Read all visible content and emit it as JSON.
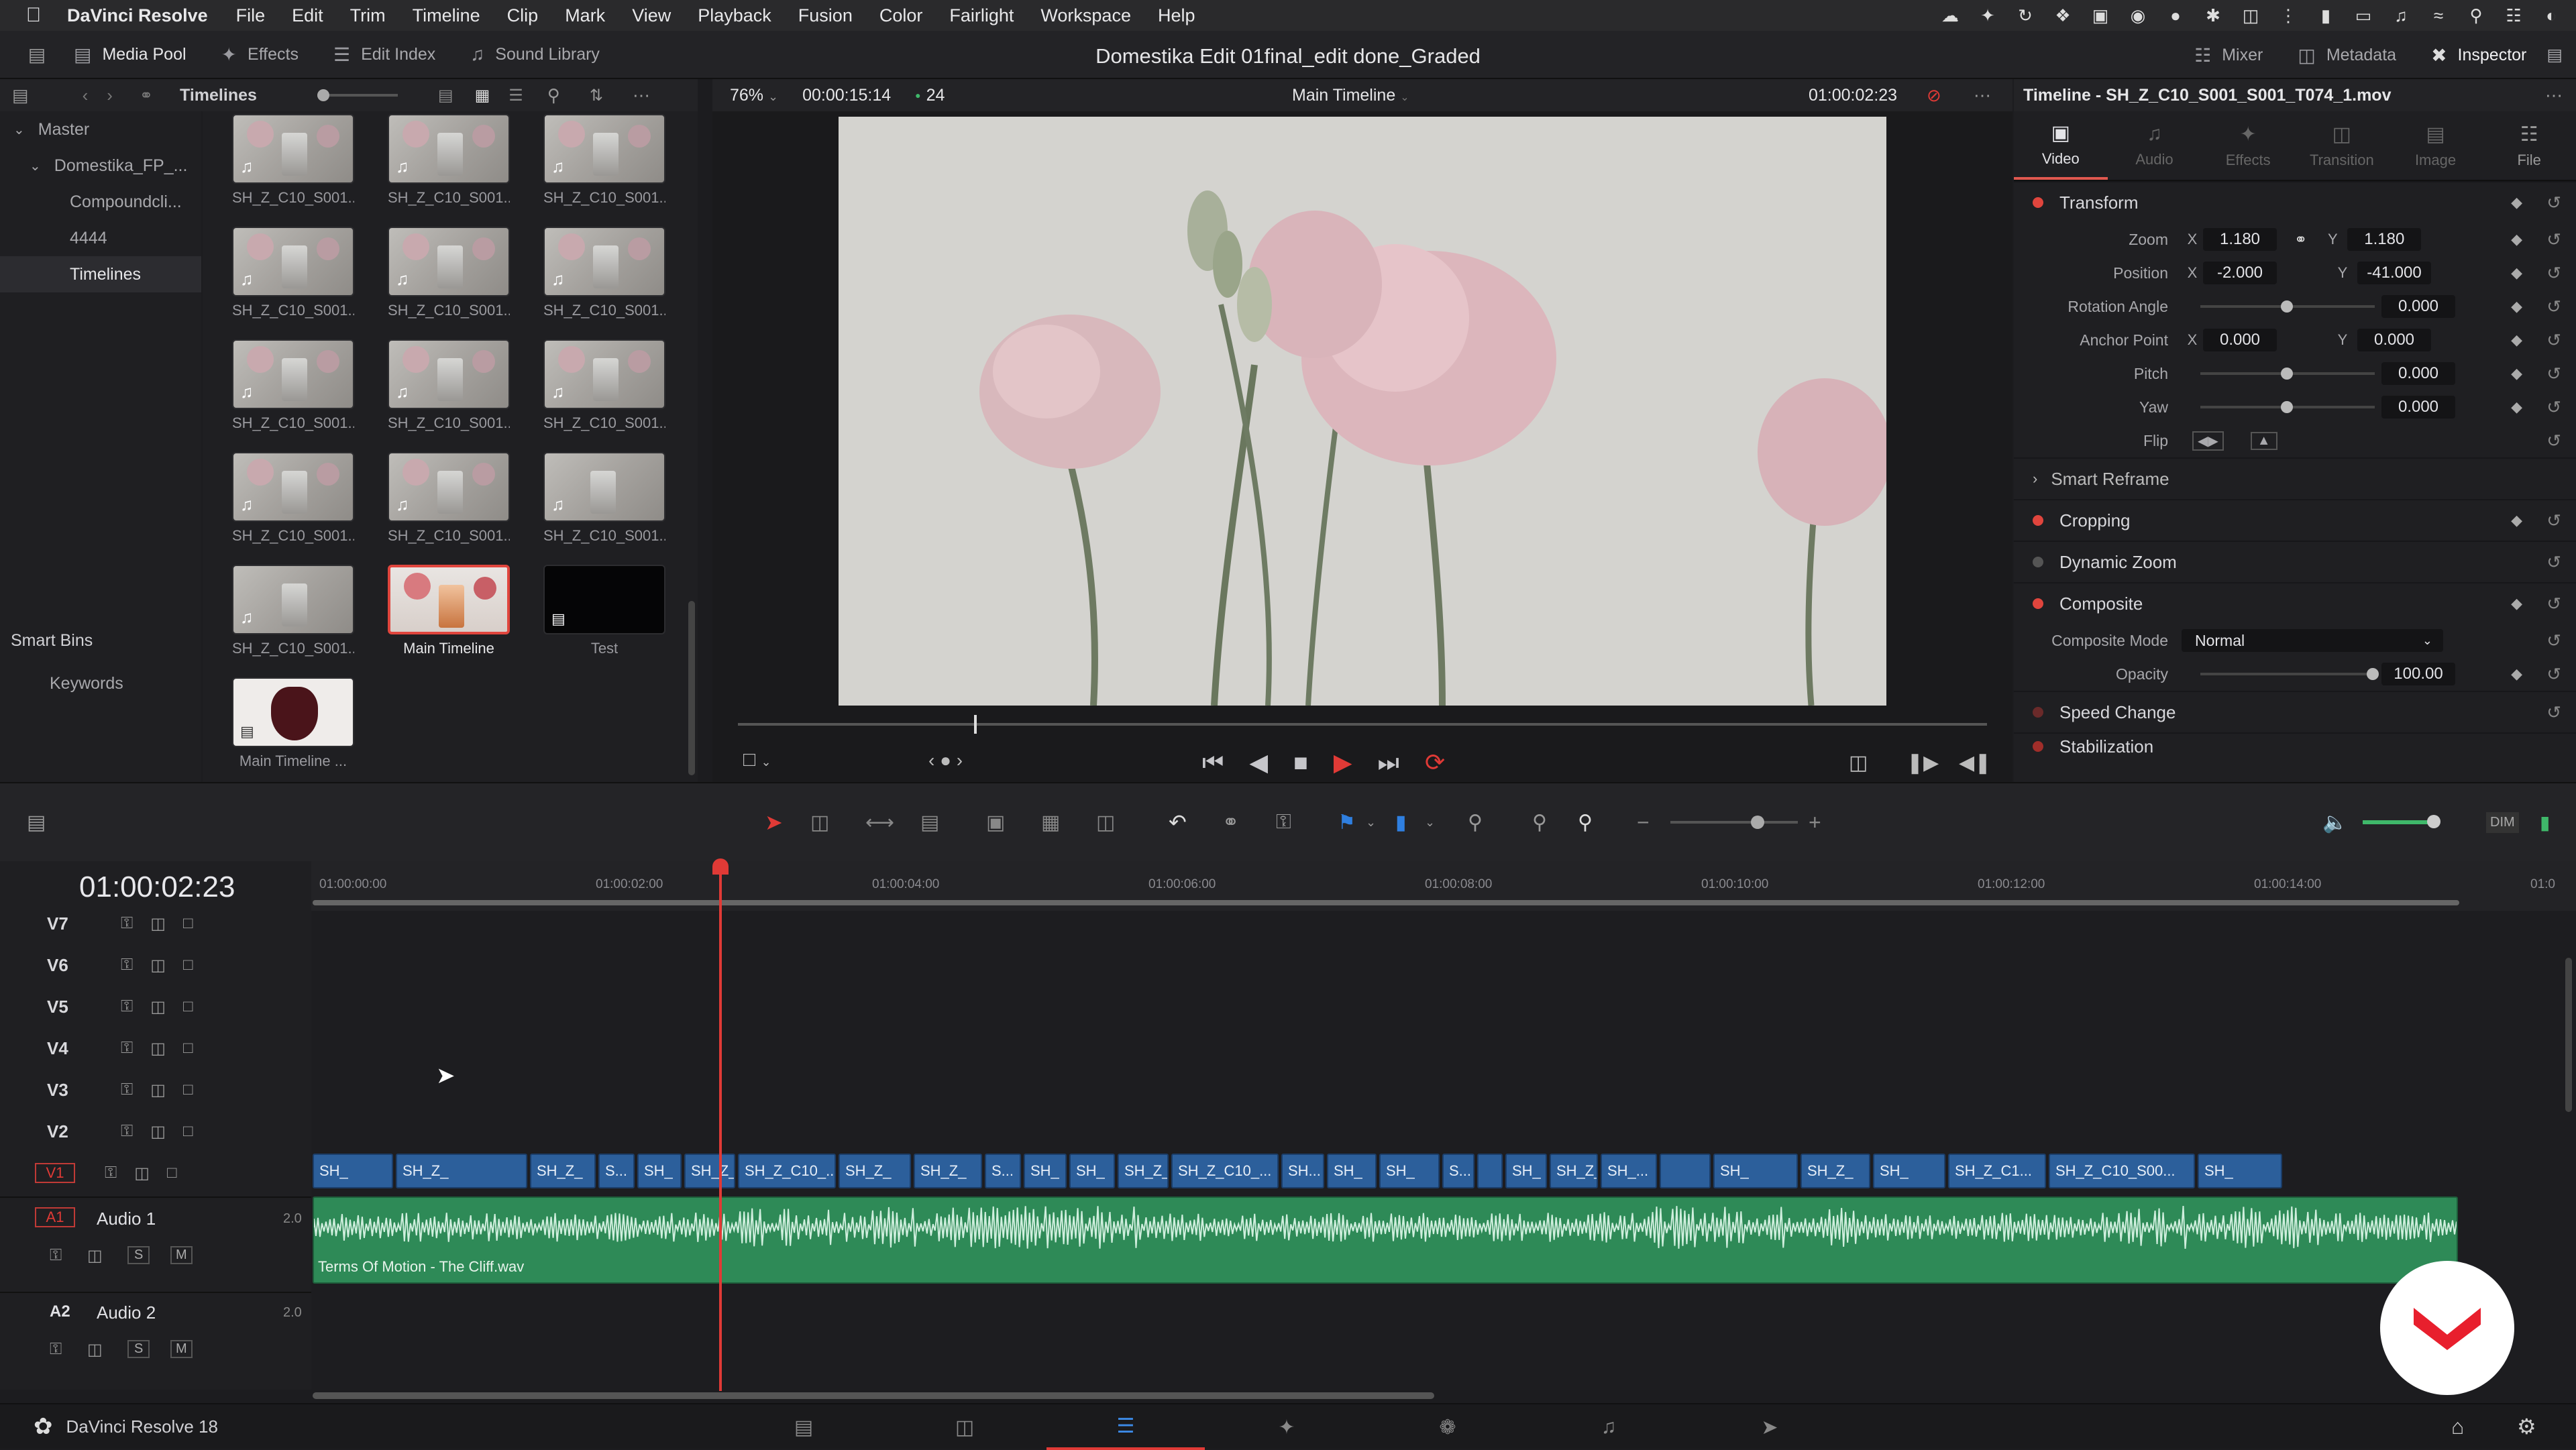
{
  "menubar": {
    "app": "DaVinci Resolve",
    "items": [
      "File",
      "Edit",
      "Trim",
      "Timeline",
      "Clip",
      "Mark",
      "View",
      "Playback",
      "Fusion",
      "Color",
      "Fairlight",
      "Workspace",
      "Help"
    ]
  },
  "toolbar": {
    "media_pool": "Media Pool",
    "effects": "Effects",
    "edit_index": "Edit Index",
    "sound_library": "Sound Library",
    "project_title": "Domestika Edit 01final_edit done_Graded",
    "mixer": "Mixer",
    "metadata": "Metadata",
    "inspector": "Inspector"
  },
  "mediapool": {
    "header": "Timelines",
    "tree": {
      "master": "Master",
      "folder": "Domestika_FP_...",
      "items": [
        "Compoundcli...",
        "4444",
        "Timelines"
      ]
    },
    "smart_bins": "Smart Bins",
    "keywords": "Keywords",
    "clips": [
      "SH_Z_C10_S001...",
      "SH_Z_C10_S001...",
      "SH_Z_C10_S001...",
      "SH_Z_C10_S001...",
      "SH_Z_C10_S001...",
      "SH_Z_C10_S001...",
      "SH_Z_C10_S001...",
      "SH_Z_C10_S001...",
      "SH_Z_C10_S001...",
      "SH_Z_C10_S001...",
      "SH_Z_C10_S001...",
      "SH_Z_C10_S001...",
      "SH_Z_C10_S001...",
      "Main Timeline",
      "Test",
      "Main Timeline ..."
    ]
  },
  "viewer": {
    "zoom": "76%",
    "duration": "00:00:15:14",
    "fps": "24",
    "timeline_name": "Main Timeline",
    "timecode": "01:00:02:23"
  },
  "inspector": {
    "title": "Timeline - SH_Z_C10_S001_S001_T074_1.mov",
    "tabs": [
      "Video",
      "Audio",
      "Effects",
      "Transition",
      "Image",
      "File"
    ],
    "transform": {
      "label": "Transform",
      "zoom_label": "Zoom",
      "zoom_x": "1.180",
      "zoom_y": "1.180",
      "position_label": "Position",
      "pos_x": "-2.000",
      "pos_y": "-41.000",
      "rotation_label": "Rotation Angle",
      "rotation": "0.000",
      "anchor_label": "Anchor Point",
      "anchor_x": "0.000",
      "anchor_y": "0.000",
      "pitch_label": "Pitch",
      "pitch": "0.000",
      "yaw_label": "Yaw",
      "yaw": "0.000",
      "flip_label": "Flip"
    },
    "smart_reframe": "Smart Reframe",
    "cropping": "Cropping",
    "dynamic_zoom": "Dynamic Zoom",
    "composite": "Composite",
    "composite_mode_label": "Composite Mode",
    "composite_mode": "Normal",
    "opacity_label": "Opacity",
    "opacity": "100.00",
    "speed_change": "Speed Change",
    "stabilization": "Stabilization",
    "x": "X",
    "y": "Y"
  },
  "timeline": {
    "timecode": "01:00:02:23",
    "ticks": [
      "01:00:00:00",
      "01:00:02:00",
      "01:00:04:00",
      "01:00:06:00",
      "01:00:08:00",
      "01:00:10:00",
      "01:00:12:00",
      "01:00:14:00",
      "01:0"
    ],
    "video_tracks": [
      "V7",
      "V6",
      "V5",
      "V4",
      "V3",
      "V2",
      "V1"
    ],
    "audio_tracks": [
      {
        "id": "A1",
        "name": "Audio 1",
        "level": "2.0"
      },
      {
        "id": "A2",
        "name": "Audio 2",
        "level": "2.0"
      }
    ],
    "audio_clip": "Terms Of Motion - The Cliff.wav",
    "s": "S",
    "m": "M",
    "clips": [
      "SH_",
      "SH_Z_",
      "SH_Z_",
      "S...",
      "SH_",
      "SH_Z_",
      "SH_Z_C10_...",
      "SH_Z_",
      "SH_Z_",
      "S...",
      "SH_",
      "SH_",
      "SH_Z_",
      "SH_Z_C10_...",
      "SH...",
      "SH_",
      "SH_",
      "S...",
      "",
      "SH_",
      "SH_Z_",
      "SH_...",
      "",
      "SH_",
      "SH_Z_",
      "SH_",
      "SH_Z_C1...",
      "SH_Z_C10_S00...",
      "SH_"
    ]
  },
  "pages": [
    "media",
    "cut",
    "edit",
    "fusion",
    "color",
    "fairlight",
    "deliver"
  ],
  "footer": {
    "app_version": "DaVinci Resolve 18"
  }
}
